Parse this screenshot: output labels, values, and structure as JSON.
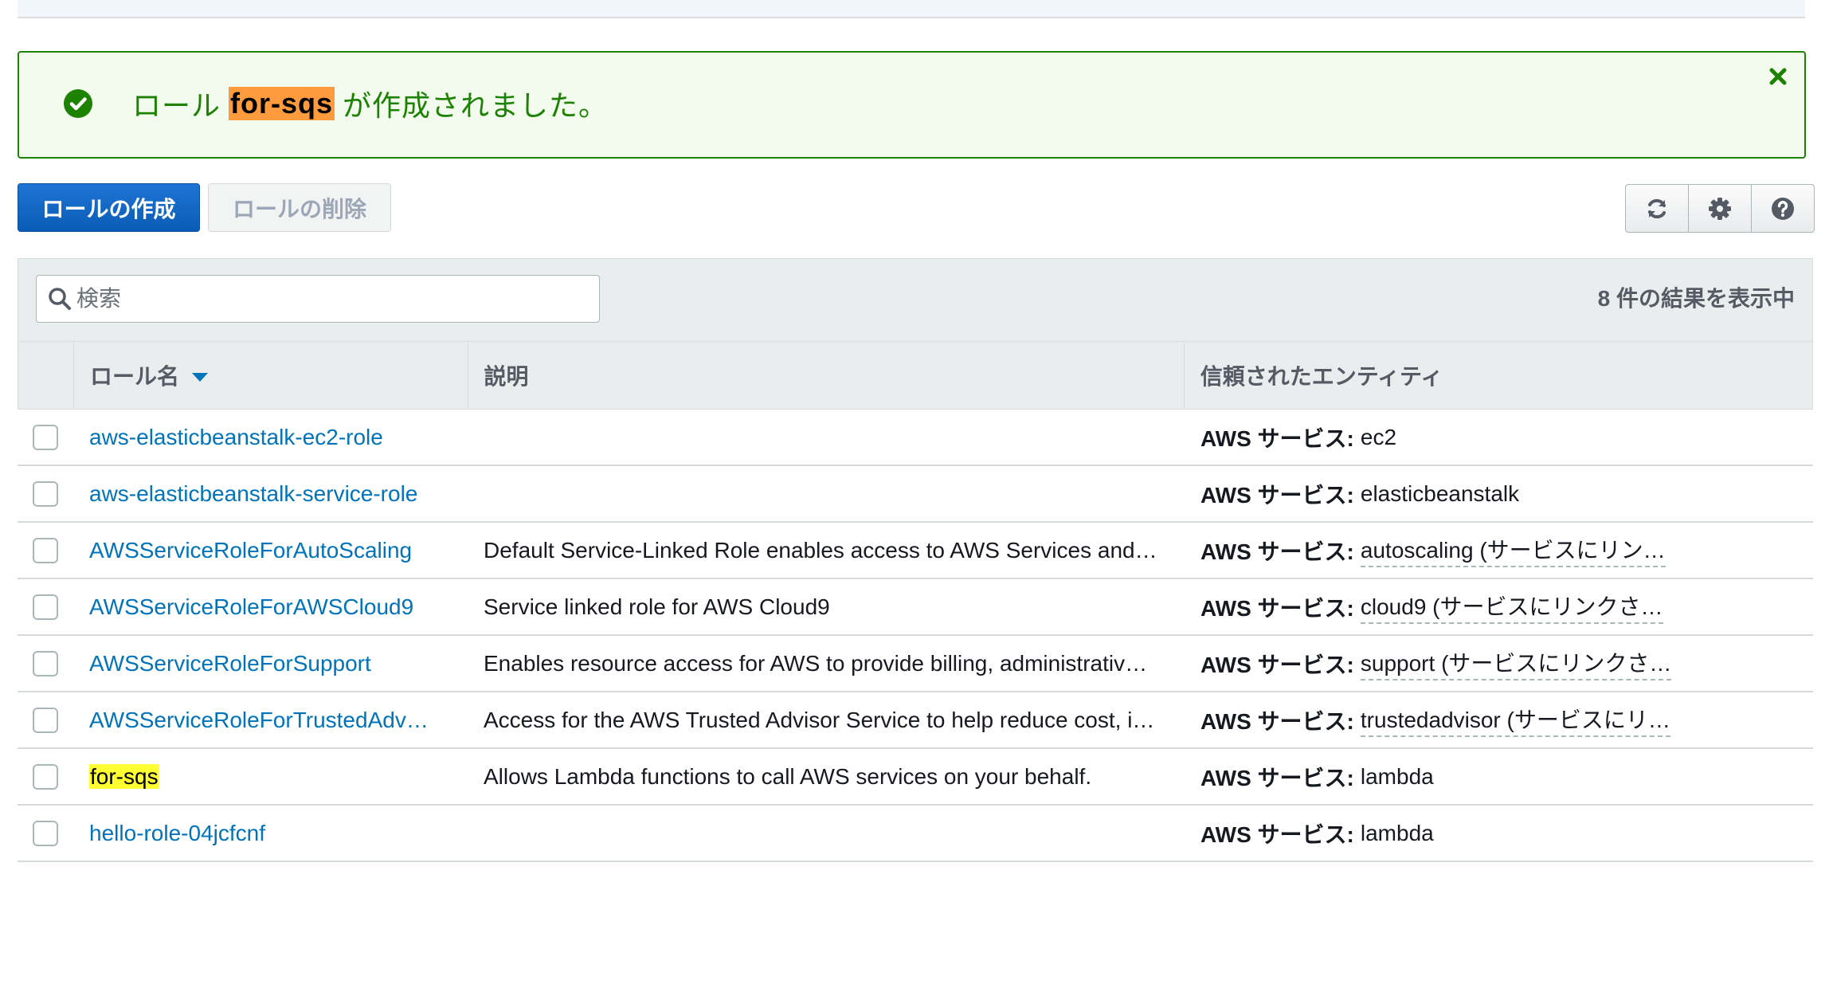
{
  "flash": {
    "prefix": "ロール",
    "role_name": "for-sqs",
    "suffix": "が作成されました。",
    "status_color": "#1d8102"
  },
  "actions": {
    "create_label": "ロールの作成",
    "delete_label": "ロールの削除",
    "icons": [
      "refresh-icon",
      "gear-icon",
      "help-icon"
    ]
  },
  "search": {
    "placeholder": "検索",
    "value": ""
  },
  "result_count": "8 件の結果を表示中",
  "table": {
    "columns": [
      "ロール名",
      "説明",
      "信頼されたエンティティ"
    ],
    "entity_prefix": "AWS サービス:",
    "rows": [
      {
        "name": "aws-elasticbeanstalk-ec2-role",
        "description": "",
        "entity": "ec2"
      },
      {
        "name": "aws-elasticbeanstalk-service-role",
        "description": "",
        "entity": "elasticbeanstalk"
      },
      {
        "name": "AWSServiceRoleForAutoScaling",
        "description": "Default Service-Linked Role enables access to AWS Services and…",
        "entity": "autoscaling (サービスにリン…"
      },
      {
        "name": "AWSServiceRoleForAWSCloud9",
        "description": "Service linked role for AWS Cloud9",
        "entity": "cloud9 (サービスにリンクさ…"
      },
      {
        "name": "AWSServiceRoleForSupport",
        "description": "Enables resource access for AWS to provide billing, administrativ…",
        "entity": "support (サービスにリンクさ…"
      },
      {
        "name": "AWSServiceRoleForTrustedAdv…",
        "description": "Access for the AWS Trusted Advisor Service to help reduce cost, i…",
        "entity": "trustedadvisor (サービスにリ…"
      },
      {
        "name": "for-sqs",
        "description": "Allows Lambda functions to call AWS services on your behalf.",
        "entity": "lambda"
      },
      {
        "name": "hello-role-04jcfcnf",
        "description": "",
        "entity": "lambda"
      }
    ]
  }
}
